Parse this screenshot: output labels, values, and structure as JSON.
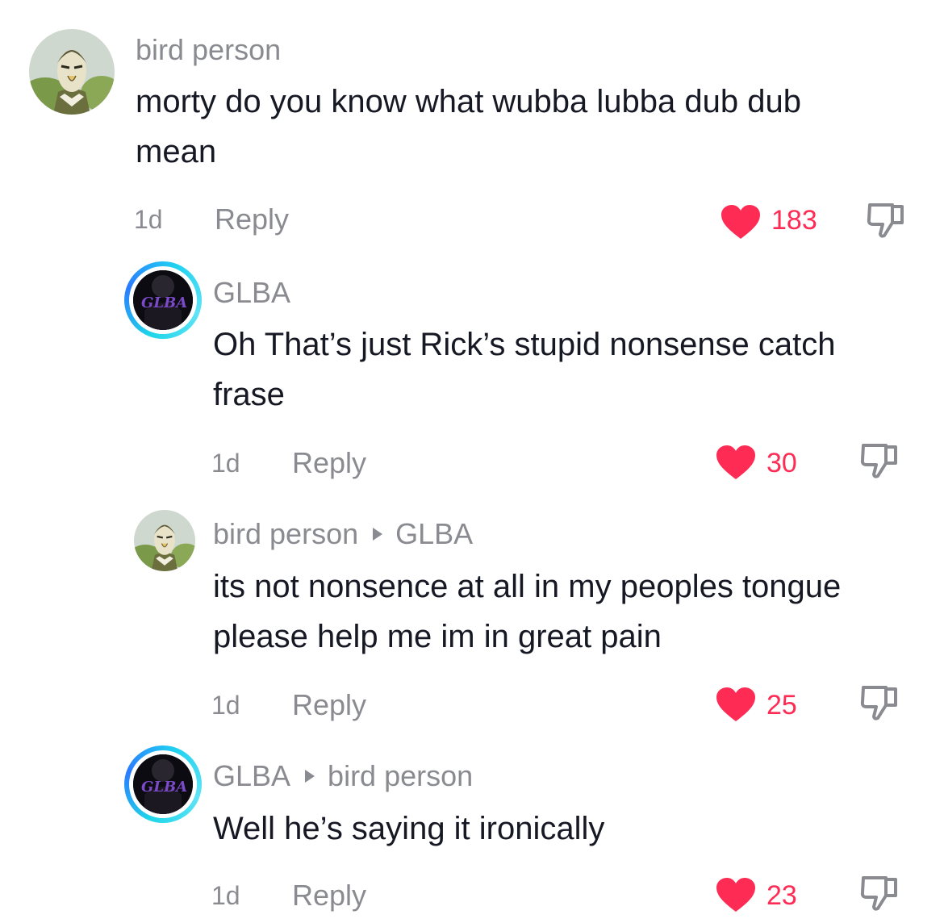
{
  "comments": [
    {
      "username": "bird person",
      "text": "morty do you know what wubba lubba dub dub mean",
      "time": "1d",
      "reply_label": "Reply",
      "likes": "183",
      "avatar_icon": "bird-person-avatar"
    },
    {
      "username": "GLBA",
      "text": "Oh That’s just Rick’s stupid nonsense catch frase",
      "time": "1d",
      "reply_label": "Reply",
      "likes": "30",
      "avatar_icon": "glba-avatar"
    },
    {
      "username": "bird person",
      "reply_to": "GLBA",
      "text": "its not nonsence at all in my peoples tongue please help me im in great pain",
      "time": "1d",
      "reply_label": "Reply",
      "likes": "25",
      "avatar_icon": "bird-person-avatar"
    },
    {
      "username": "GLBA",
      "reply_to": "bird person",
      "text": "Well he’s saying it ironically",
      "time": "1d",
      "reply_label": "Reply",
      "likes": "23",
      "avatar_icon": "glba-avatar"
    }
  ],
  "colors": {
    "like": "#fe2c55",
    "meta": "#8a8b91",
    "text": "#161823",
    "ring": "#1fd6e8"
  },
  "icons": {
    "like": "heart-icon",
    "dislike": "thumbs-down-icon",
    "reply_arrow": "caret-right-icon"
  }
}
